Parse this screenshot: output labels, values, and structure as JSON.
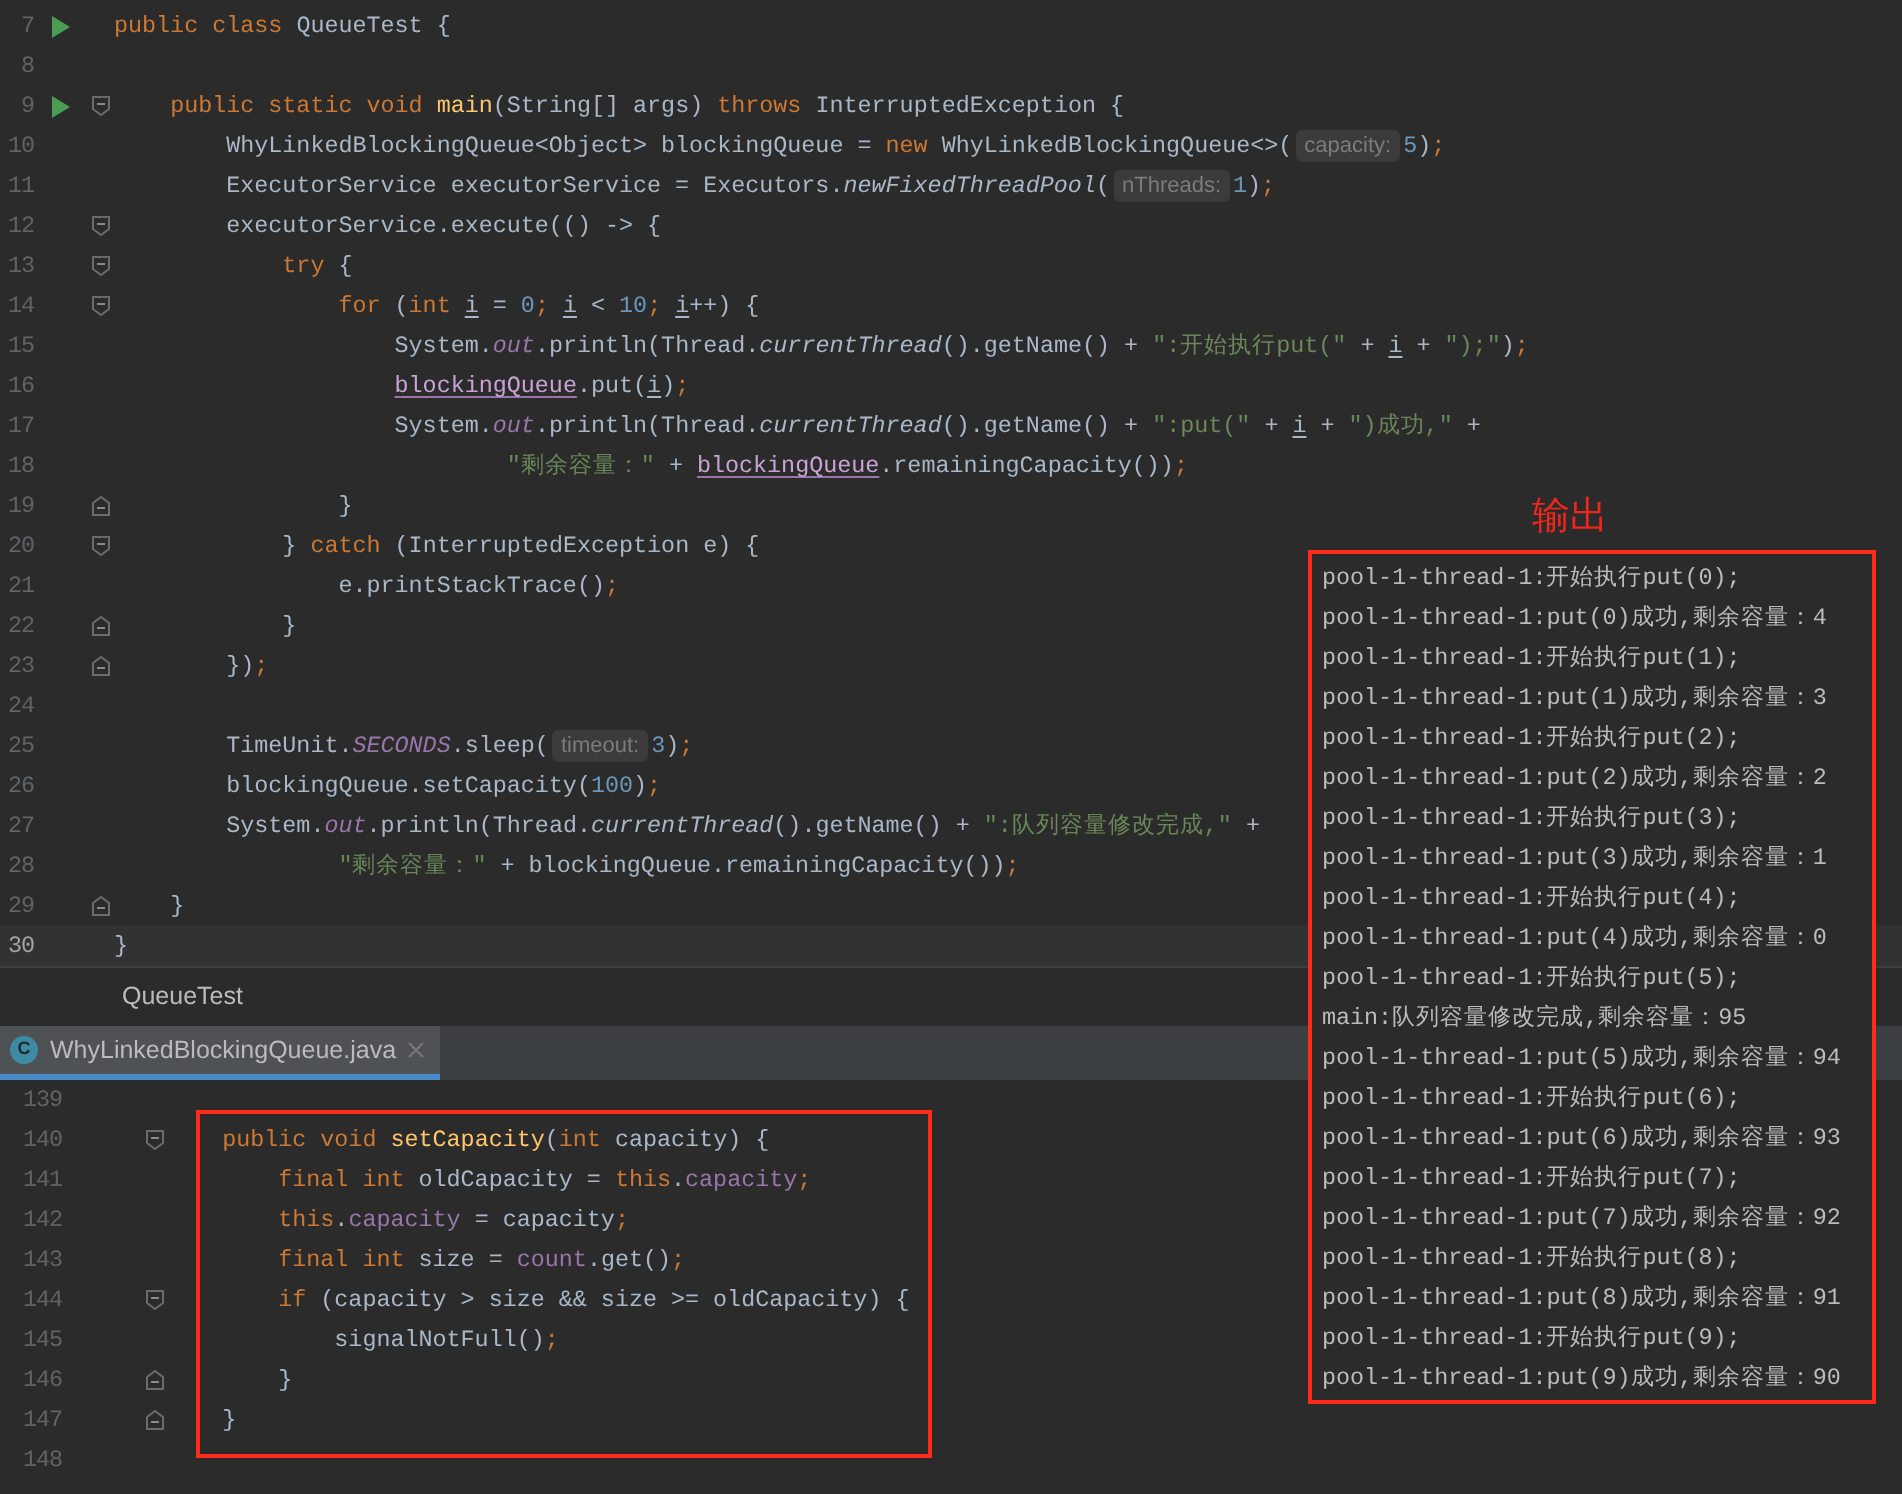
{
  "editor": {
    "lines": [
      {
        "number": "7",
        "run": true,
        "fold_start": false,
        "fold_end": false,
        "current": false,
        "tokens": [
          {
            "kind": "keyword",
            "text": "public class "
          },
          {
            "kind": "plain",
            "text": "QueueTest {"
          }
        ]
      },
      {
        "number": "8",
        "run": false,
        "fold_start": false,
        "fold_end": false,
        "current": false
      },
      {
        "number": "9",
        "run": true,
        "fold_start": true,
        "fold_end": false,
        "current": false,
        "tokens": [
          {
            "kind": "keyword",
            "text": "    public static void "
          },
          {
            "kind": "method-decl",
            "text": "main"
          },
          {
            "kind": "plain",
            "text": "(String[] args) "
          },
          {
            "kind": "keyword",
            "text": "throws "
          },
          {
            "kind": "plain",
            "text": "InterruptedException {"
          }
        ]
      },
      {
        "number": "10",
        "run": false,
        "fold_start": false,
        "fold_end": false,
        "current": false,
        "tokens": [
          {
            "kind": "plain",
            "text": "        WhyLinkedBlockingQueue<Object> blockingQueue = "
          },
          {
            "kind": "keyword",
            "text": "new "
          },
          {
            "kind": "plain",
            "text": "WhyLinkedBlockingQueue<>("
          },
          {
            "kind": "hint",
            "text": "capacity:"
          },
          {
            "kind": "number",
            "text": "5"
          },
          {
            "kind": "plain",
            "text": ")"
          },
          {
            "kind": "keyword",
            "text": ";"
          }
        ]
      },
      {
        "number": "11",
        "run": false,
        "fold_start": false,
        "fold_end": false,
        "current": false,
        "tokens": [
          {
            "kind": "plain",
            "text": "        ExecutorService executorService = Executors."
          },
          {
            "kind": "static-method",
            "text": "newFixedThreadPool"
          },
          {
            "kind": "plain",
            "text": "("
          },
          {
            "kind": "hint",
            "text": "nThreads:"
          },
          {
            "kind": "number",
            "text": "1"
          },
          {
            "kind": "plain",
            "text": ")"
          },
          {
            "kind": "keyword",
            "text": ";"
          }
        ]
      },
      {
        "number": "12",
        "run": false,
        "fold_start": true,
        "fold_end": false,
        "current": false,
        "tokens": [
          {
            "kind": "plain",
            "text": "        executorService.execute(() -> {"
          }
        ]
      },
      {
        "number": "13",
        "run": false,
        "fold_start": true,
        "fold_end": false,
        "current": false,
        "tokens": [
          {
            "kind": "keyword",
            "text": "            try "
          },
          {
            "kind": "plain",
            "text": "{"
          }
        ]
      },
      {
        "number": "14",
        "run": false,
        "fold_start": true,
        "fold_end": false,
        "current": false,
        "tokens": [
          {
            "kind": "keyword",
            "text": "                for "
          },
          {
            "kind": "plain",
            "text": "("
          },
          {
            "kind": "keyword",
            "text": "int "
          },
          {
            "kind": "loop-var",
            "text": "i"
          },
          {
            "kind": "plain",
            "text": " = "
          },
          {
            "kind": "number",
            "text": "0"
          },
          {
            "kind": "keyword",
            "text": "; "
          },
          {
            "kind": "loop-var",
            "text": "i"
          },
          {
            "kind": "plain",
            "text": " < "
          },
          {
            "kind": "number",
            "text": "10"
          },
          {
            "kind": "keyword",
            "text": "; "
          },
          {
            "kind": "loop-var",
            "text": "i"
          },
          {
            "kind": "plain",
            "text": "++) {"
          }
        ]
      },
      {
        "number": "15",
        "run": false,
        "fold_start": false,
        "fold_end": false,
        "current": false,
        "tokens": [
          {
            "kind": "plain",
            "text": "                    System."
          },
          {
            "kind": "static-field",
            "text": "out"
          },
          {
            "kind": "plain",
            "text": ".println(Thread."
          },
          {
            "kind": "static-method",
            "text": "currentThread"
          },
          {
            "kind": "plain",
            "text": "().getName() + "
          },
          {
            "kind": "string",
            "text": "\":开始执行put(\""
          },
          {
            "kind": "plain",
            "text": " + "
          },
          {
            "kind": "loop-var",
            "text": "i"
          },
          {
            "kind": "plain",
            "text": " + "
          },
          {
            "kind": "string",
            "text": "\");\""
          },
          {
            "kind": "plain",
            "text": ")"
          },
          {
            "kind": "keyword",
            "text": ";"
          }
        ]
      },
      {
        "number": "16",
        "run": false,
        "fold_start": false,
        "fold_end": false,
        "current": false,
        "tokens": [
          {
            "kind": "captured-var",
            "text": "                    blockingQueue"
          },
          {
            "kind": "plain",
            "text": ".put("
          },
          {
            "kind": "loop-var",
            "text": "i"
          },
          {
            "kind": "plain",
            "text": ")"
          },
          {
            "kind": "keyword",
            "text": ";"
          }
        ]
      },
      {
        "number": "17",
        "run": false,
        "fold_start": false,
        "fold_end": false,
        "current": false,
        "tokens": [
          {
            "kind": "plain",
            "text": "                    System."
          },
          {
            "kind": "static-field",
            "text": "out"
          },
          {
            "kind": "plain",
            "text": ".println(Thread."
          },
          {
            "kind": "static-method",
            "text": "currentThread"
          },
          {
            "kind": "plain",
            "text": "().getName() + "
          },
          {
            "kind": "string",
            "text": "\":put(\""
          },
          {
            "kind": "plain",
            "text": " + "
          },
          {
            "kind": "loop-var",
            "text": "i"
          },
          {
            "kind": "plain",
            "text": " + "
          },
          {
            "kind": "string",
            "text": "\")成功,\""
          },
          {
            "kind": "plain",
            "text": " +"
          }
        ]
      },
      {
        "number": "18",
        "run": false,
        "fold_start": false,
        "fold_end": false,
        "current": false,
        "tokens": [
          {
            "kind": "string",
            "text": "                            \"剩余容量：\""
          },
          {
            "kind": "plain",
            "text": " + "
          },
          {
            "kind": "captured-var",
            "text": "blockingQueue"
          },
          {
            "kind": "plain",
            "text": ".remainingCapacity())"
          },
          {
            "kind": "keyword",
            "text": ";"
          }
        ]
      },
      {
        "number": "19",
        "run": false,
        "fold_start": false,
        "fold_end": true,
        "current": false,
        "tokens": [
          {
            "kind": "plain",
            "text": "                }"
          }
        ]
      },
      {
        "number": "20",
        "run": false,
        "fold_start": true,
        "fold_end": false,
        "current": false,
        "tokens": [
          {
            "kind": "plain",
            "text": "            } "
          },
          {
            "kind": "keyword",
            "text": "catch "
          },
          {
            "kind": "plain",
            "text": "(InterruptedException e) {"
          }
        ]
      },
      {
        "number": "21",
        "run": false,
        "fold_start": false,
        "fold_end": false,
        "current": false,
        "tokens": [
          {
            "kind": "plain",
            "text": "                e.printStackTrace()"
          },
          {
            "kind": "keyword",
            "text": ";"
          }
        ]
      },
      {
        "number": "22",
        "run": false,
        "fold_start": false,
        "fold_end": true,
        "current": false,
        "tokens": [
          {
            "kind": "plain",
            "text": "            }"
          }
        ]
      },
      {
        "number": "23",
        "run": false,
        "fold_start": false,
        "fold_end": true,
        "current": false,
        "tokens": [
          {
            "kind": "plain",
            "text": "        })"
          },
          {
            "kind": "keyword",
            "text": ";"
          }
        ]
      },
      {
        "number": "24",
        "run": false,
        "fold_start": false,
        "fold_end": false,
        "current": false
      },
      {
        "number": "25",
        "run": false,
        "fold_start": false,
        "fold_end": false,
        "current": false,
        "tokens": [
          {
            "kind": "plain",
            "text": "        TimeUnit."
          },
          {
            "kind": "static-field",
            "text": "SECONDS"
          },
          {
            "kind": "plain",
            "text": ".sleep("
          },
          {
            "kind": "hint",
            "text": "timeout:"
          },
          {
            "kind": "number",
            "text": "3"
          },
          {
            "kind": "plain",
            "text": ")"
          },
          {
            "kind": "keyword",
            "text": ";"
          }
        ]
      },
      {
        "number": "26",
        "run": false,
        "fold_start": false,
        "fold_end": false,
        "current": false,
        "tokens": [
          {
            "kind": "plain",
            "text": "        blockingQueue.setCapacity("
          },
          {
            "kind": "number",
            "text": "100"
          },
          {
            "kind": "plain",
            "text": ")"
          },
          {
            "kind": "keyword",
            "text": ";"
          }
        ]
      },
      {
        "number": "27",
        "run": false,
        "fold_start": false,
        "fold_end": false,
        "current": false,
        "tokens": [
          {
            "kind": "plain",
            "text": "        System."
          },
          {
            "kind": "static-field",
            "text": "out"
          },
          {
            "kind": "plain",
            "text": ".println(Thread."
          },
          {
            "kind": "static-method",
            "text": "currentThread"
          },
          {
            "kind": "plain",
            "text": "().getName() + "
          },
          {
            "kind": "string",
            "text": "\":队列容量修改完成,\""
          },
          {
            "kind": "plain",
            "text": " +"
          }
        ]
      },
      {
        "number": "28",
        "run": false,
        "fold_start": false,
        "fold_end": false,
        "current": false,
        "tokens": [
          {
            "kind": "string",
            "text": "                \"剩余容量：\""
          },
          {
            "kind": "plain",
            "text": " + blockingQueue.remainingCapacity())"
          },
          {
            "kind": "keyword",
            "text": ";"
          }
        ]
      },
      {
        "number": "29",
        "run": false,
        "fold_start": false,
        "fold_end": true,
        "current": false,
        "tokens": [
          {
            "kind": "plain",
            "text": "    }"
          }
        ]
      },
      {
        "number": "30",
        "run": false,
        "fold_start": false,
        "fold_end": false,
        "current": true,
        "tokens": [
          {
            "kind": "plain",
            "text": "}"
          }
        ]
      }
    ]
  },
  "breadcrumb": "QueueTest",
  "tabs": [
    {
      "label": "WhyLinkedBlockingQueue.java",
      "icon_letter": "C",
      "selected": true
    }
  ],
  "source_editor": {
    "lines": [
      {
        "number": "139",
        "fold_start": false,
        "fold_end": false
      },
      {
        "number": "140",
        "fold_start": true,
        "fold_end": false,
        "tokens": [
          {
            "kind": "keyword",
            "text": "    public void "
          },
          {
            "kind": "method-decl",
            "text": "setCapacity"
          },
          {
            "kind": "plain",
            "text": "("
          },
          {
            "kind": "keyword",
            "text": "int "
          },
          {
            "kind": "plain",
            "text": "capacity) {"
          }
        ]
      },
      {
        "number": "141",
        "fold_start": false,
        "fold_end": false,
        "tokens": [
          {
            "kind": "keyword",
            "text": "        final int "
          },
          {
            "kind": "plain",
            "text": "oldCapacity = "
          },
          {
            "kind": "keyword",
            "text": "this"
          },
          {
            "kind": "plain",
            "text": "."
          },
          {
            "kind": "field",
            "text": "capacity"
          },
          {
            "kind": "keyword",
            "text": ";"
          }
        ]
      },
      {
        "number": "142",
        "fold_start": false,
        "fold_end": false,
        "tokens": [
          {
            "kind": "keyword",
            "text": "        this"
          },
          {
            "kind": "plain",
            "text": "."
          },
          {
            "kind": "field",
            "text": "capacity"
          },
          {
            "kind": "plain",
            "text": " = capacity"
          },
          {
            "kind": "keyword",
            "text": ";"
          }
        ]
      },
      {
        "number": "143",
        "fold_start": false,
        "fold_end": false,
        "tokens": [
          {
            "kind": "keyword",
            "text": "        final int "
          },
          {
            "kind": "plain",
            "text": "size = "
          },
          {
            "kind": "field",
            "text": "count"
          },
          {
            "kind": "plain",
            "text": ".get()"
          },
          {
            "kind": "keyword",
            "text": ";"
          }
        ]
      },
      {
        "number": "144",
        "fold_start": true,
        "fold_end": false,
        "tokens": [
          {
            "kind": "keyword",
            "text": "        if "
          },
          {
            "kind": "plain",
            "text": "(capacity > size && size >= oldCapacity) {"
          }
        ]
      },
      {
        "number": "145",
        "fold_start": false,
        "fold_end": false,
        "tokens": [
          {
            "kind": "plain",
            "text": "            signalNotFull()"
          },
          {
            "kind": "keyword",
            "text": ";"
          }
        ]
      },
      {
        "number": "146",
        "fold_start": false,
        "fold_end": true,
        "tokens": [
          {
            "kind": "plain",
            "text": "        }"
          }
        ]
      },
      {
        "number": "147",
        "fold_start": false,
        "fold_end": true,
        "tokens": [
          {
            "kind": "plain",
            "text": "    }"
          }
        ]
      },
      {
        "number": "148",
        "fold_start": false,
        "fold_end": false
      }
    ]
  },
  "output": {
    "title": "输出",
    "lines": [
      "pool-1-thread-1:开始执行put(0);",
      "pool-1-thread-1:put(0)成功,剩余容量：4",
      "pool-1-thread-1:开始执行put(1);",
      "pool-1-thread-1:put(1)成功,剩余容量：3",
      "pool-1-thread-1:开始执行put(2);",
      "pool-1-thread-1:put(2)成功,剩余容量：2",
      "pool-1-thread-1:开始执行put(3);",
      "pool-1-thread-1:put(3)成功,剩余容量：1",
      "pool-1-thread-1:开始执行put(4);",
      "pool-1-thread-1:put(4)成功,剩余容量：0",
      "pool-1-thread-1:开始执行put(5);",
      "main:队列容量修改完成,剩余容量：95",
      "pool-1-thread-1:put(5)成功,剩余容量：94",
      "pool-1-thread-1:开始执行put(6);",
      "pool-1-thread-1:put(6)成功,剩余容量：93",
      "pool-1-thread-1:开始执行put(7);",
      "pool-1-thread-1:put(7)成功,剩余容量：92",
      "pool-1-thread-1:开始执行put(8);",
      "pool-1-thread-1:put(8)成功,剩余容量：91",
      "pool-1-thread-1:开始执行put(9);",
      "pool-1-thread-1:put(9)成功,剩余容量：90"
    ]
  }
}
